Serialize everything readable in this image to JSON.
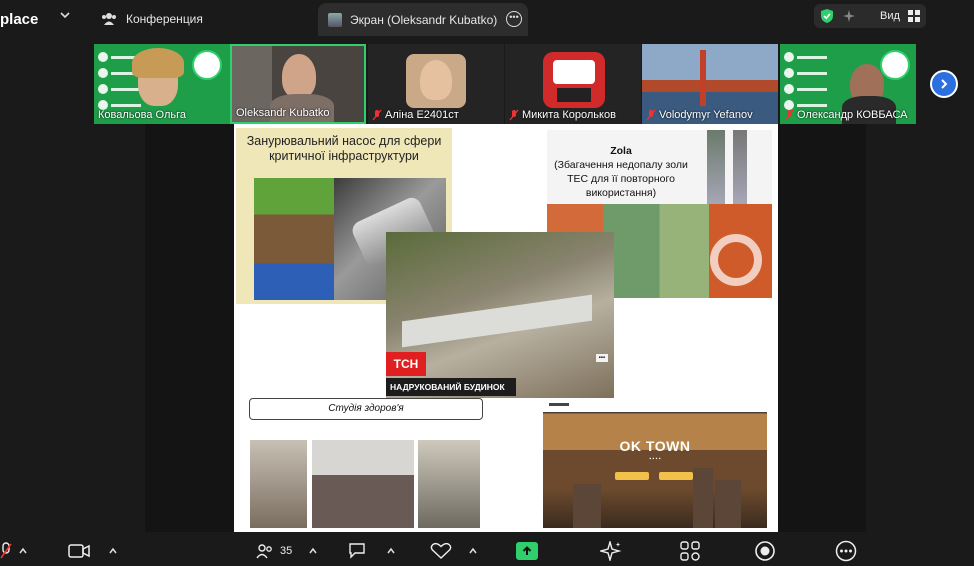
{
  "app": {
    "title": "place"
  },
  "tabs": [
    {
      "label": "Конференция"
    },
    {
      "label": "Экран (Oleksandr Kubatko)"
    }
  ],
  "top_right": {
    "view_label": "Вид"
  },
  "participants": [
    {
      "name": "Ковальова Ольга"
    },
    {
      "name": "Oleksandr Kubatko"
    },
    {
      "name": "Аліна Е2401ст"
    },
    {
      "name": "Микита Корольков"
    },
    {
      "name": "Volodymyr Yefanov"
    },
    {
      "name": "Олександр КОВБАСА"
    }
  ],
  "slide": {
    "pump_title": "Занурювальний насос для сфери критичної інфраструктури",
    "zola_title": "Zola",
    "zola_subtitle": "(Збагачення недопалу золи ТЕС для її повторного використання)",
    "tsn_logo": "ТСН",
    "house_caption": "НАДРУКОВАНИЙ БУДИНОК",
    "studio_label": "Студія здоров'я",
    "oktown_title": "OK TOWN"
  },
  "toolbar": {
    "participants_count": "35"
  },
  "colors": {
    "accent_green": "#2fcf6b",
    "blue_button": "#2b6fe0"
  }
}
